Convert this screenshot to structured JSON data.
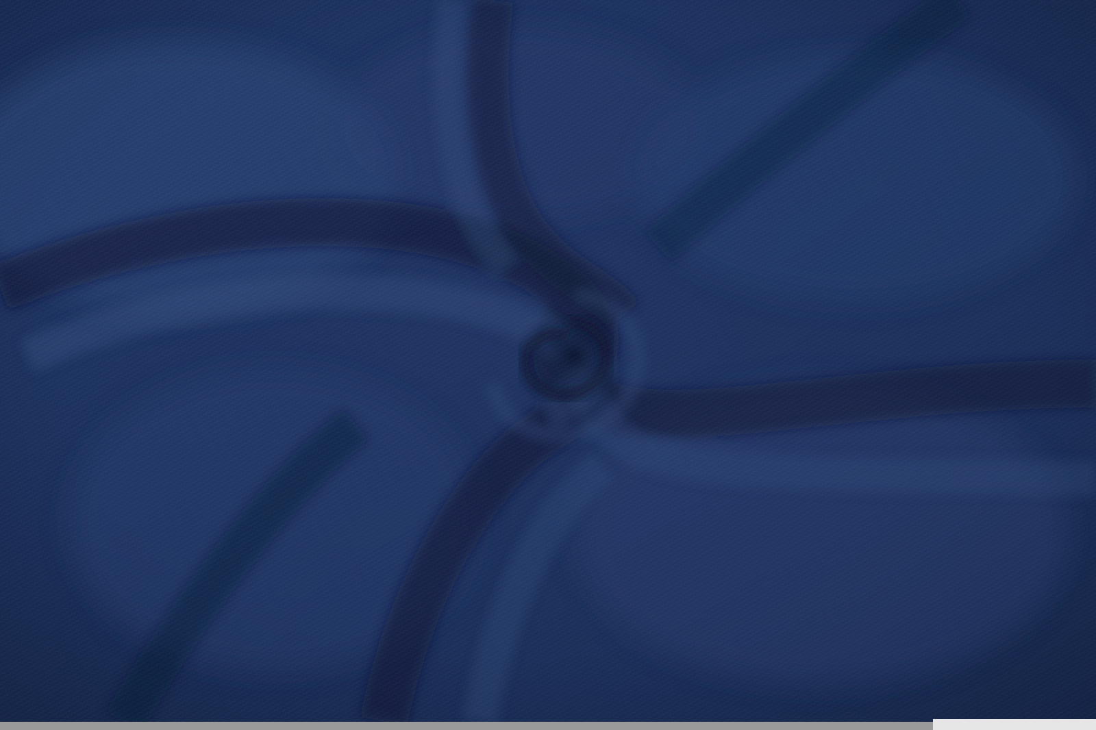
{
  "image": {
    "subject": "navy-knit-fabric-swirl",
    "colors": {
      "base": "#1f3563",
      "shadow": "#0f1a33",
      "highlight": "#3a5286",
      "strip_gray": "#9a9a9a",
      "strip_light": "#e6e6e6"
    }
  }
}
